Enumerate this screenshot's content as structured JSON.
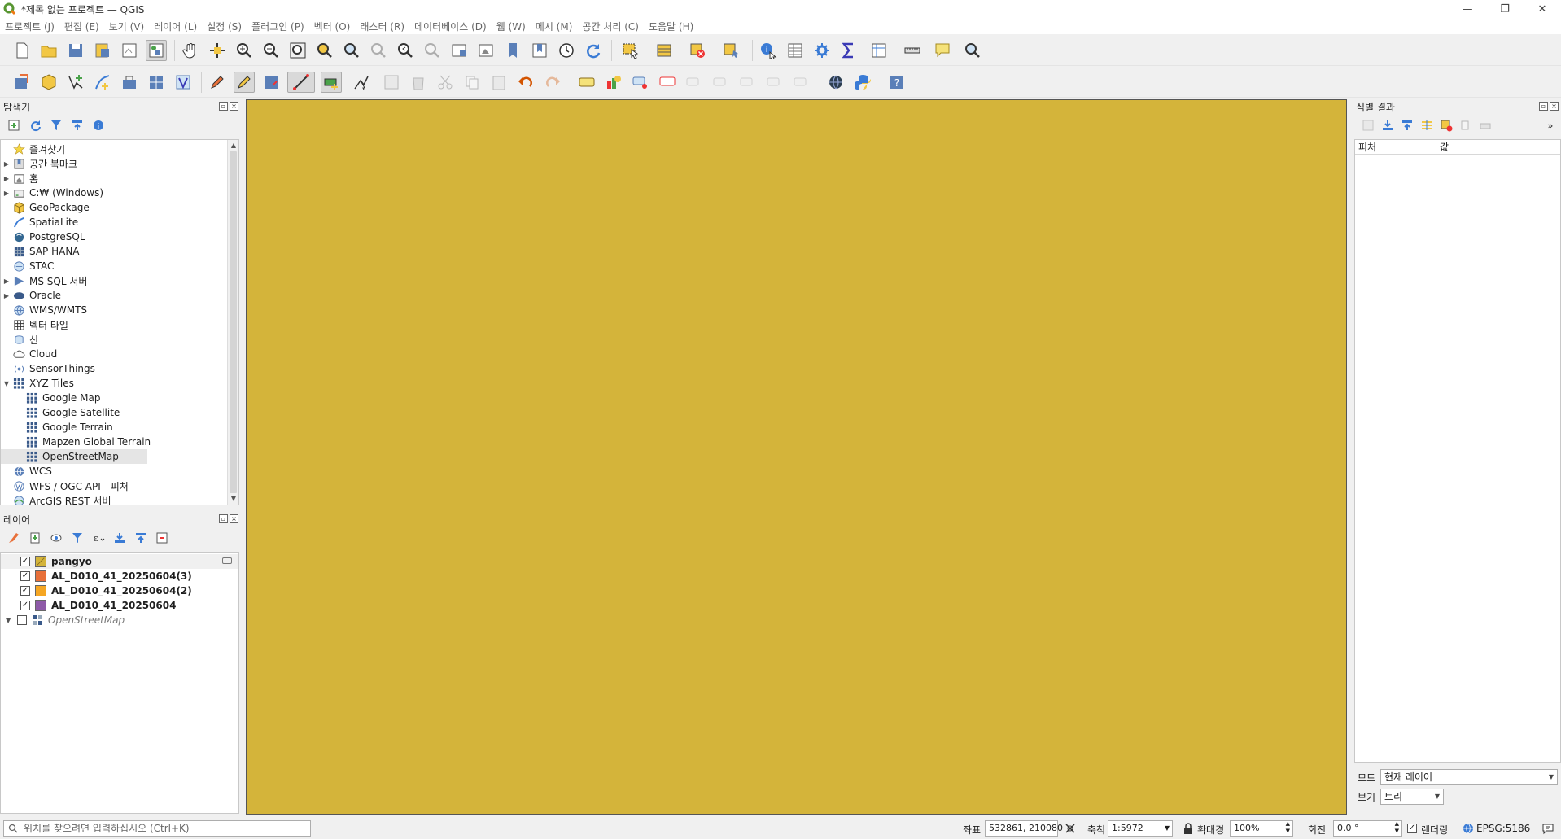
{
  "window": {
    "title": "*제목 없는 프로젝트 — QGIS",
    "minimize": "—",
    "maximize": "❐",
    "close": "✕"
  },
  "menu": [
    "프로젝트 (J)",
    "편집 (E)",
    "보기 (V)",
    "레이어 (L)",
    "설정 (S)",
    "플러그인 (P)",
    "벡터 (O)",
    "래스터 (R)",
    "데이터베이스 (D)",
    "웹 (W)",
    "메시 (M)",
    "공간 처리 (C)",
    "도움말 (H)"
  ],
  "browser": {
    "title": "탐색기",
    "items": [
      {
        "label": "즐겨찾기",
        "icon": "star-icon",
        "arrow": ""
      },
      {
        "label": "공간 북마크",
        "icon": "bookmark-icon",
        "arrow": "▶"
      },
      {
        "label": "홈",
        "icon": "home-folder-icon",
        "arrow": "▶"
      },
      {
        "label": "C:₩ (Windows)",
        "icon": "drive-icon",
        "arrow": "▶"
      },
      {
        "label": "GeoPackage",
        "icon": "geopackage-icon",
        "arrow": ""
      },
      {
        "label": "SpatiaLite",
        "icon": "spatialite-icon",
        "arrow": ""
      },
      {
        "label": "PostgreSQL",
        "icon": "postgresql-icon",
        "arrow": ""
      },
      {
        "label": "SAP HANA",
        "icon": "sap-hana-icon",
        "arrow": ""
      },
      {
        "label": "STAC",
        "icon": "stac-icon",
        "arrow": ""
      },
      {
        "label": "MS SQL 서버",
        "icon": "mssql-icon",
        "arrow": "▶"
      },
      {
        "label": "Oracle",
        "icon": "oracle-icon",
        "arrow": "▶"
      },
      {
        "label": "WMS/WMTS",
        "icon": "wms-icon",
        "arrow": ""
      },
      {
        "label": "벡터 타일",
        "icon": "vector-tile-icon",
        "arrow": ""
      },
      {
        "label": "신",
        "icon": "scene-icon",
        "arrow": ""
      },
      {
        "label": "Cloud",
        "icon": "cloud-icon",
        "arrow": ""
      },
      {
        "label": "SensorThings",
        "icon": "sensorthings-icon",
        "arrow": ""
      },
      {
        "label": "XYZ Tiles",
        "icon": "xyz-tiles-icon",
        "arrow": "▼"
      },
      {
        "label": "Google Map",
        "icon": "xyz-tile-icon",
        "arrow": "",
        "child": true
      },
      {
        "label": "Google Satellite",
        "icon": "xyz-tile-icon",
        "arrow": "",
        "child": true
      },
      {
        "label": "Google Terrain",
        "icon": "xyz-tile-icon",
        "arrow": "",
        "child": true
      },
      {
        "label": "Mapzen Global Terrain",
        "icon": "xyz-tile-icon",
        "arrow": "",
        "child": true
      },
      {
        "label": "OpenStreetMap",
        "icon": "xyz-tile-icon",
        "arrow": "",
        "child": true,
        "selected": true
      },
      {
        "label": "WCS",
        "icon": "wcs-icon",
        "arrow": ""
      },
      {
        "label": "WFS / OGC API - 피처",
        "icon": "wfs-icon",
        "arrow": ""
      },
      {
        "label": "ArcGIS REST 서버",
        "icon": "arcgis-icon",
        "arrow": ""
      }
    ]
  },
  "layers": {
    "title": "레이어",
    "items": [
      {
        "label": "pangyo",
        "checked": "✓",
        "color": "#d4b43a",
        "style": "underline"
      },
      {
        "label": "AL_D010_41_20250604(3)",
        "checked": "✓",
        "color": "#e8703a",
        "style": "bold"
      },
      {
        "label": "AL_D010_41_20250604(2)",
        "checked": "✓",
        "color": "#f5a623",
        "style": "bold"
      },
      {
        "label": "AL_D010_41_20250604",
        "checked": "✓",
        "color": "#8e5aa8",
        "style": "bold"
      },
      {
        "label": "OpenStreetMap",
        "checked": "",
        "color": "",
        "style": "italic"
      }
    ]
  },
  "map": {
    "background": "#d4b43a"
  },
  "identify": {
    "title": "식별 결과",
    "col_feature": "피처",
    "col_value": "값",
    "mode_label": "모드",
    "mode_value": "현재 레이어",
    "view_label": "보기",
    "view_value": "트리"
  },
  "status": {
    "locator_placeholder": "위치를 찾으려면 입력하십시오 (Ctrl+K)",
    "coord_label": "좌표",
    "coord_value": "532861, 210080",
    "scale_label": "축척",
    "scale_value": "1:5972",
    "magnifier_label": "확대경",
    "magnifier_value": "100%",
    "rotation_label": "회전",
    "rotation_value": "0.0 °",
    "render_label": "렌더링",
    "crs": "EPSG:5186"
  }
}
